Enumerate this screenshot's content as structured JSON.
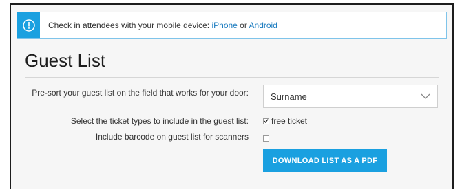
{
  "notice": {
    "icon": "info-icon",
    "text_prefix": "Check in attendees with your mobile device: ",
    "iphone_link": "iPhone",
    "separator": " or ",
    "android_link": "Android"
  },
  "page": {
    "title": "Guest List"
  },
  "form": {
    "presort_label": "Pre-sort your guest list on the field that works for your door:",
    "presort_value": "Surname",
    "ticket_types_label": "Select the ticket types to include in the guest list:",
    "ticket_option_label": "free ticket",
    "ticket_option_checked": true,
    "barcode_label": "Include barcode on guest list for scanners",
    "barcode_checked": false,
    "download_button": "DOWNLOAD LIST AS A PDF"
  },
  "colors": {
    "accent": "#1aa0e0",
    "link": "#1a7bbf",
    "notice_border": "#7fc4ea",
    "background": "#f6f6f6"
  }
}
